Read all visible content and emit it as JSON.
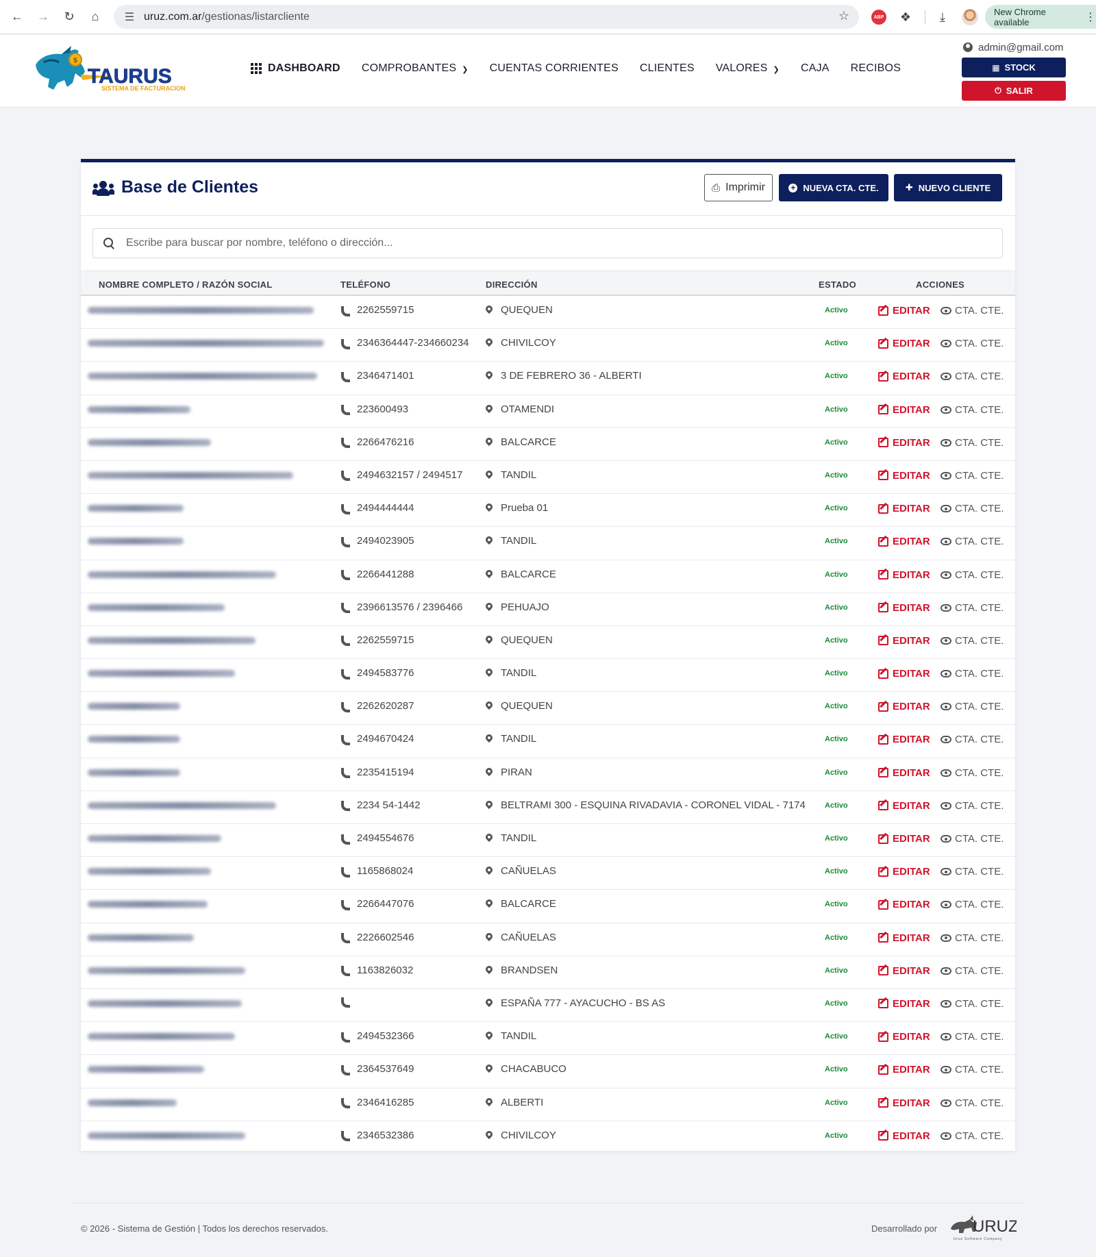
{
  "browser": {
    "url_host": "uruz.com.ar",
    "url_path": "/gestionas/listarcliente",
    "update_label": "New Chrome available",
    "abp_label": "ABP"
  },
  "header": {
    "brand": "TAURUS",
    "brand_sub": "SISTEMA DE FACTURACION",
    "nav": [
      {
        "label": "DASHBOARD"
      },
      {
        "label": "COMPROBANTES"
      },
      {
        "label": "CUENTAS CORRIENTES"
      },
      {
        "label": "CLIENTES"
      },
      {
        "label": "VALORES"
      },
      {
        "label": "CAJA"
      },
      {
        "label": "RECIBOS"
      }
    ],
    "user_email": "admin@gmail.com",
    "stock_label": "STOCK",
    "salir_label": "SALIR"
  },
  "card": {
    "title": "Base de Clientes",
    "print_label": "Imprimir",
    "new_account_label": "NUEVA CTA. CTE.",
    "new_client_label": "NUEVO CLIENTE",
    "search_placeholder": "Escribe para buscar por nombre, teléfono o dirección..."
  },
  "table": {
    "columns": {
      "name": "NOMBRE COMPLETO / RAZÓN SOCIAL",
      "phone": "TELÉFONO",
      "address": "DIRECCIÓN",
      "status": "ESTADO",
      "actions": "ACCIONES"
    },
    "edit_label": "EDITAR",
    "account_label": "CTA. CTE.",
    "rows": [
      {
        "phone": "2262559715",
        "address": "QUEQUEN",
        "status": "Activo"
      },
      {
        "phone": "2346364447-234660234",
        "address": "CHIVILCOY",
        "status": "Activo"
      },
      {
        "phone": "2346471401",
        "address": "3 DE FEBRERO 36 - ALBERTI",
        "status": "Activo"
      },
      {
        "phone": "223600493",
        "address": "OTAMENDI",
        "status": "Activo"
      },
      {
        "phone": "2266476216",
        "address": "BALCARCE",
        "status": "Activo"
      },
      {
        "phone": "2494632157 / 2494517",
        "address": "TANDIL",
        "status": "Activo"
      },
      {
        "phone": "2494444444",
        "address": "Prueba 01",
        "status": "Activo"
      },
      {
        "phone": "2494023905",
        "address": "TANDIL",
        "status": "Activo"
      },
      {
        "phone": "2266441288",
        "address": "BALCARCE",
        "status": "Activo"
      },
      {
        "phone": "2396613576 / 2396466",
        "address": "PEHUAJO",
        "status": "Activo"
      },
      {
        "phone": "2262559715",
        "address": "QUEQUEN",
        "status": "Activo"
      },
      {
        "phone": "2494583776",
        "address": "TANDIL",
        "status": "Activo"
      },
      {
        "phone": "2262620287",
        "address": "QUEQUEN",
        "status": "Activo"
      },
      {
        "phone": "2494670424",
        "address": "TANDIL",
        "status": "Activo"
      },
      {
        "phone": "2235415194",
        "address": "PIRAN",
        "status": "Activo"
      },
      {
        "phone": "2234 54-1442",
        "address": "BELTRAMI 300 - ESQUINA RIVADAVIA - CORONEL VIDAL - 7174",
        "status": "Activo"
      },
      {
        "phone": "2494554676",
        "address": "TANDIL",
        "status": "Activo"
      },
      {
        "phone": "1165868024",
        "address": "CAÑUELAS",
        "status": "Activo"
      },
      {
        "phone": "2266447076",
        "address": "BALCARCE",
        "status": "Activo"
      },
      {
        "phone": "2226602546",
        "address": "CAÑUELAS",
        "status": "Activo"
      },
      {
        "phone": "1163826032",
        "address": "BRANDSEN",
        "status": "Activo"
      },
      {
        "phone": "",
        "address": "ESPAÑA 777 - AYACUCHO - BS AS",
        "status": "Activo"
      },
      {
        "phone": "2494532366",
        "address": "TANDIL",
        "status": "Activo"
      },
      {
        "phone": "2364537649",
        "address": "CHACABUCO",
        "status": "Activo"
      },
      {
        "phone": "2346416285",
        "address": "ALBERTI",
        "status": "Activo"
      },
      {
        "phone": "2346532386",
        "address": "CHIVILCOY",
        "status": "Activo"
      }
    ]
  },
  "footer": {
    "copyright": "© 2026 - Sistema de Gestión | Todos los derechos reservados.",
    "developed_by": "Desarrollado por",
    "dev_brand": "URUZ",
    "dev_tagline": "Uruz Software Company"
  },
  "colors": {
    "primary": "#0d1f5c",
    "danger": "#d0142c",
    "success": "#1a8a3a"
  },
  "icons": {
    "nav_dashboard": "grid-icon",
    "card_title": "users-icon",
    "phone": "phone-icon",
    "address": "map-pin-icon",
    "edit": "edit-icon",
    "account": "eye-icon"
  }
}
